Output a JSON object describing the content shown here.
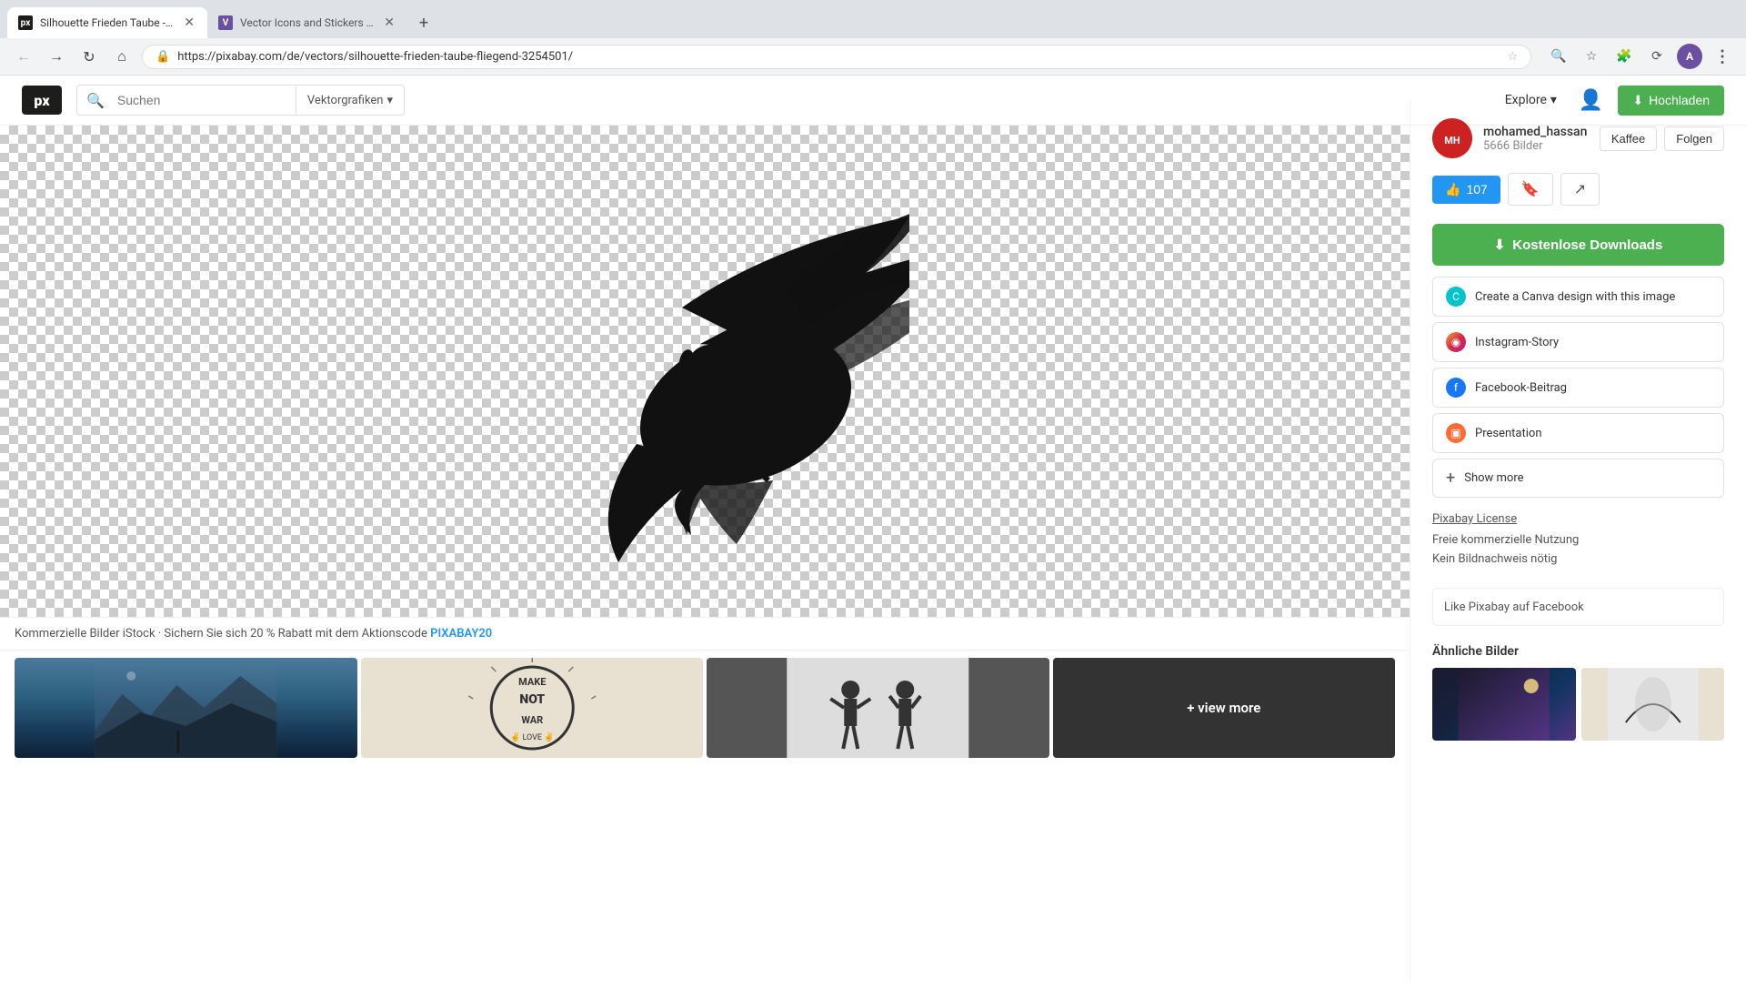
{
  "browser": {
    "tabs": [
      {
        "id": "tab1",
        "title": "Silhouette Frieden Taube - Kost...",
        "url": "https://www.pixabay.com/de/vectors/silhouette-frieden-taube-fliegend-3254501/",
        "favicon": "px",
        "active": true
      },
      {
        "id": "tab2",
        "title": "Vector Icons and Stickers - PNG",
        "url": "",
        "favicon": "vi",
        "active": false
      }
    ],
    "address": "https://pixabay.com/de/vectors/silhouette-frieden-taube-fliegend-3254501/",
    "new_tab_label": "+"
  },
  "header": {
    "logo": "px",
    "search_placeholder": "Suchen",
    "search_category": "Vektorgrafiken",
    "explore_label": "Explore",
    "upload_label": "Hochladen"
  },
  "sidebar": {
    "author": {
      "name": "mohamed_hassan",
      "image_count": "5666 Bilder",
      "kaffee_label": "Kaffee",
      "folgen_label": "Folgen"
    },
    "actions": {
      "like_count": "107",
      "bookmark_icon": "🔖",
      "share_icon": "↗"
    },
    "download_btn_label": "Kostenlose Downloads",
    "canva_options": [
      {
        "id": "canva",
        "label": "Create a Canva design with this image",
        "icon": "C",
        "icon_type": "canva"
      },
      {
        "id": "instagram",
        "label": "Instagram-Story",
        "icon": "◉",
        "icon_type": "instagram"
      },
      {
        "id": "facebook",
        "label": "Facebook-Beitrag",
        "icon": "f",
        "icon_type": "facebook"
      },
      {
        "id": "presentation",
        "label": "Presentation",
        "icon": "▣",
        "icon_type": "presentation"
      }
    ],
    "show_more_label": "Show more",
    "license": {
      "title": "Pixabay License",
      "line1": "Freie kommerzielle Nutzung",
      "line2": "Kein Bildnachweis nötig"
    },
    "facebook_section": {
      "text": "Like Pixabay auf Facebook"
    },
    "similar_section": {
      "title": "Ähnliche Bilder"
    }
  },
  "image": {
    "promo_text": "Kommerzielle Bilder iStock · Sichern Sie sich 20 % Rabatt mit dem Aktionscode",
    "promo_code": "PIXABAY20",
    "view_more_label": "+ view more"
  }
}
